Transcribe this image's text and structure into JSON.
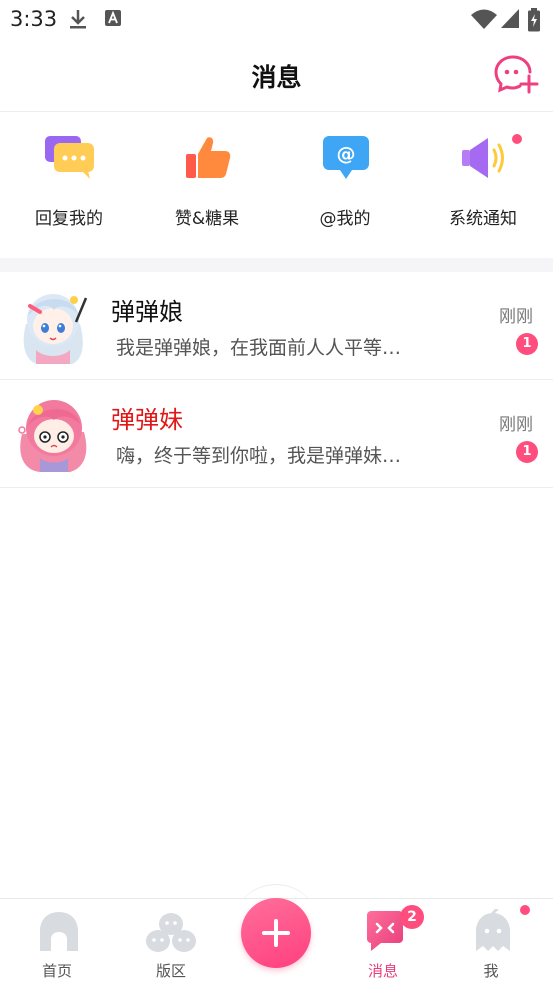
{
  "status_bar": {
    "time": "3:33"
  },
  "header": {
    "title": "消息"
  },
  "quick_actions": [
    {
      "label": "回复我的",
      "icon": "reply-chat-icon"
    },
    {
      "label": "赞&糖果",
      "icon": "thumbs-up-icon"
    },
    {
      "label": "@我的",
      "icon": "at-mention-icon"
    },
    {
      "label": "系统通知",
      "icon": "speaker-icon",
      "has_dot": true
    }
  ],
  "conversations": [
    {
      "name": "弹弹娘",
      "preview": "我是弹弹娘，在我面前人人平等…",
      "time": "刚刚",
      "unread": "1",
      "name_color": "#111111"
    },
    {
      "name": "弹弹妹",
      "preview": "嗨，终于等到你啦，我是弹弹妹…",
      "time": "刚刚",
      "unread": "1",
      "name_color": "#e01818"
    }
  ],
  "bottom_nav": {
    "items": [
      {
        "label": "首页",
        "icon": "home-icon"
      },
      {
        "label": "版区",
        "icon": "section-icon"
      },
      {
        "label": "消息",
        "icon": "message-icon",
        "active": true,
        "badge": "2"
      },
      {
        "label": "我",
        "icon": "profile-icon",
        "has_dot": true
      }
    ]
  },
  "colors": {
    "accent": "#ff4d7e",
    "active_nav": "#e73d7b"
  }
}
